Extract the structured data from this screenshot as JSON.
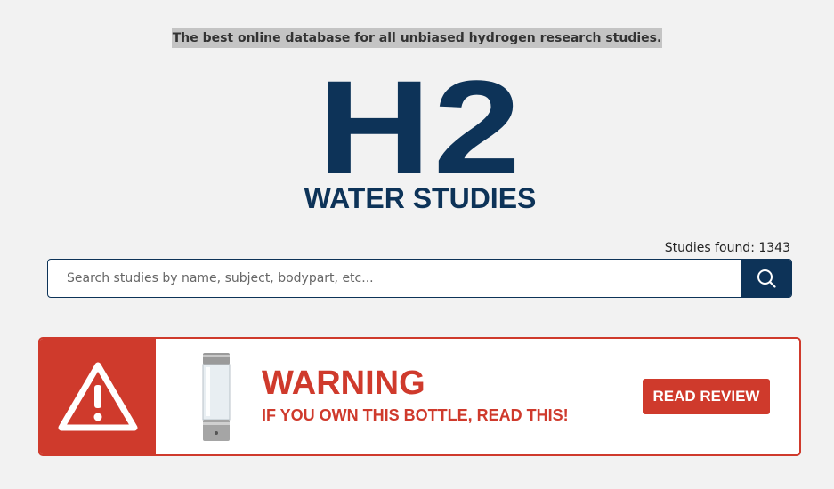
{
  "header": {
    "tagline": "The best online database for all unbiased hydrogen research studies."
  },
  "logo": {
    "main": "H2",
    "subtitle": "WATER STUDIES",
    "color": "#0d3358"
  },
  "search": {
    "count_text": "Studies found: 1343",
    "placeholder": "Search studies by name, subject, bodypart, etc...",
    "value": "",
    "icon": "search-icon"
  },
  "banner": {
    "accent_color": "#cf3a2c",
    "icon": "warning-triangle-icon",
    "image": "hydrogen-bottle",
    "title": "WARNING",
    "subtitle": "IF YOU OWN THIS BOTTLE, READ THIS!",
    "button_label": "READ REVIEW"
  }
}
